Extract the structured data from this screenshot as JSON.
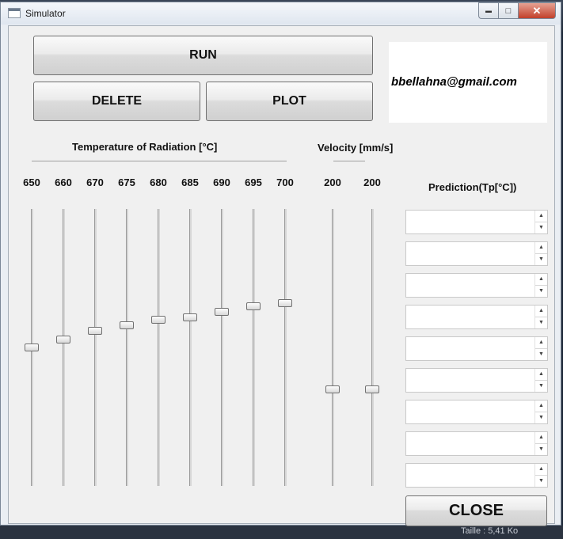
{
  "window": {
    "title": "Simulator",
    "minimize_glyph": "▬",
    "maximize_glyph": "□",
    "close_glyph": "✕"
  },
  "buttons": {
    "run": "RUN",
    "delete": "DELETE",
    "plot": "PLOT",
    "close": "CLOSE"
  },
  "email": "bbellahna@gmail.com",
  "temperature": {
    "heading": "Temperature of Radiation [°C]",
    "sliders": [
      {
        "label": "650",
        "level": 0.5
      },
      {
        "label": "660",
        "level": 0.53
      },
      {
        "label": "670",
        "level": 0.56
      },
      {
        "label": "675",
        "level": 0.58
      },
      {
        "label": "680",
        "level": 0.6
      },
      {
        "label": "685",
        "level": 0.61
      },
      {
        "label": "690",
        "level": 0.63
      },
      {
        "label": "695",
        "level": 0.65
      },
      {
        "label": "700",
        "level": 0.66
      }
    ]
  },
  "velocity": {
    "heading": "Velocity [mm/s]",
    "sliders": [
      {
        "label": "200",
        "level": 0.35
      },
      {
        "label": "200",
        "level": 0.35
      }
    ]
  },
  "prediction": {
    "heading": "Prediction(Tp[°C])",
    "fields": [
      "",
      "",
      "",
      "",
      "",
      "",
      "",
      "",
      ""
    ],
    "up_glyph": "▲",
    "down_glyph": "▼"
  },
  "background": {
    "status_text": "Taille : 5,41 Ko"
  }
}
